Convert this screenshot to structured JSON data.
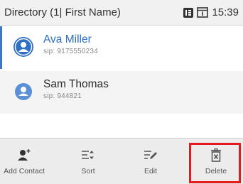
{
  "status_bar": {
    "title": "Directory (1| First Name)",
    "time": "15:39",
    "icons": [
      "phone-status-icon",
      "voicemail-icon"
    ]
  },
  "contacts": [
    {
      "name": "Ava Miller",
      "number": "sip: 9175550234",
      "selected": true,
      "icon": "person-icon"
    },
    {
      "name": "Sam Thomas",
      "number": "sip: 944821",
      "selected": false,
      "icon": "person-icon"
    }
  ],
  "soft_keys": [
    {
      "label": "Add Contact",
      "icon": "add-contact-icon"
    },
    {
      "label": "Sort",
      "icon": "sort-icon"
    },
    {
      "label": "Edit",
      "icon": "edit-icon"
    },
    {
      "label": "Delete",
      "icon": "delete-icon",
      "highlighted": true
    }
  ],
  "colors": {
    "accent": "#2c6fc2",
    "highlight": "#e8191d",
    "avatar_selected": "#2f6fc4",
    "avatar_unselected": "#5b8fd6"
  }
}
